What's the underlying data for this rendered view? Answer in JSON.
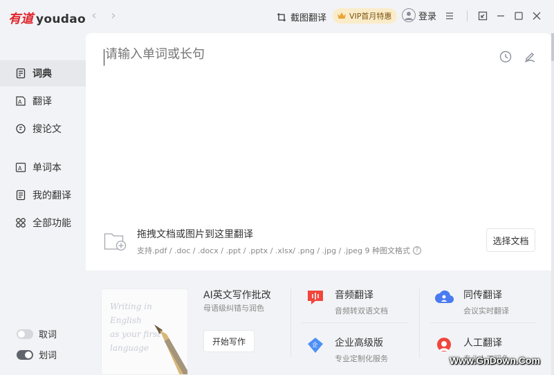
{
  "app": {
    "logo_cn": "有道",
    "logo_en": "youdao"
  },
  "titlebar": {
    "screenshot_translate": "截图翻译",
    "vip": "VIP首月特惠",
    "login": "登录"
  },
  "sidebar": {
    "items": [
      {
        "label": "词典",
        "icon": "dictionary-icon",
        "active": true
      },
      {
        "label": "翻译",
        "icon": "translate-icon"
      },
      {
        "label": "搜论文",
        "icon": "search-paper-icon"
      },
      {
        "label": "单词本",
        "icon": "wordbook-icon"
      },
      {
        "label": "我的翻译",
        "icon": "my-translation-icon"
      },
      {
        "label": "全部功能",
        "icon": "all-features-icon"
      }
    ],
    "toggles": [
      {
        "label": "取词",
        "on": false
      },
      {
        "label": "划词",
        "on": true
      }
    ]
  },
  "search": {
    "placeholder": "请输入单词或长句"
  },
  "drop": {
    "title": "拖拽文档或图片到这里翻译",
    "formats": "支持.pdf / .doc / .docx / .ppt / .pptx / .xlsx/ .png / .jpg / .jpeg 9 种图文格式",
    "choose_label": "选择文档"
  },
  "ai_writing": {
    "title": "AI英文写作批改",
    "subtitle": "母语级纠错与润色",
    "button": "开始写作",
    "art_lines": [
      "Writing in",
      "English",
      "as your first",
      "language"
    ]
  },
  "features": [
    {
      "title": "音频翻译",
      "subtitle": "音频转双语文档",
      "icon": "audio-translate-icon",
      "color": "#f0463c"
    },
    {
      "title": "同传翻译",
      "subtitle": "会议实时翻译",
      "icon": "simultaneous-translate-icon",
      "color": "#4a7bf0"
    },
    {
      "title": "企业高级版",
      "subtitle": "专业定制化服务",
      "icon": "enterprise-icon",
      "color": "#4d8ff5"
    },
    {
      "title": "人工翻译",
      "subtitle": "专业人工润色",
      "icon": "human-translate-icon",
      "color": "#f0463c"
    }
  ],
  "watermark": "Www.GnDown.Com",
  "colors": {
    "brand": "#e0242b",
    "vip_bg": "#fbecc9",
    "panel": "#ffffff",
    "background": "#f2f3f6"
  }
}
